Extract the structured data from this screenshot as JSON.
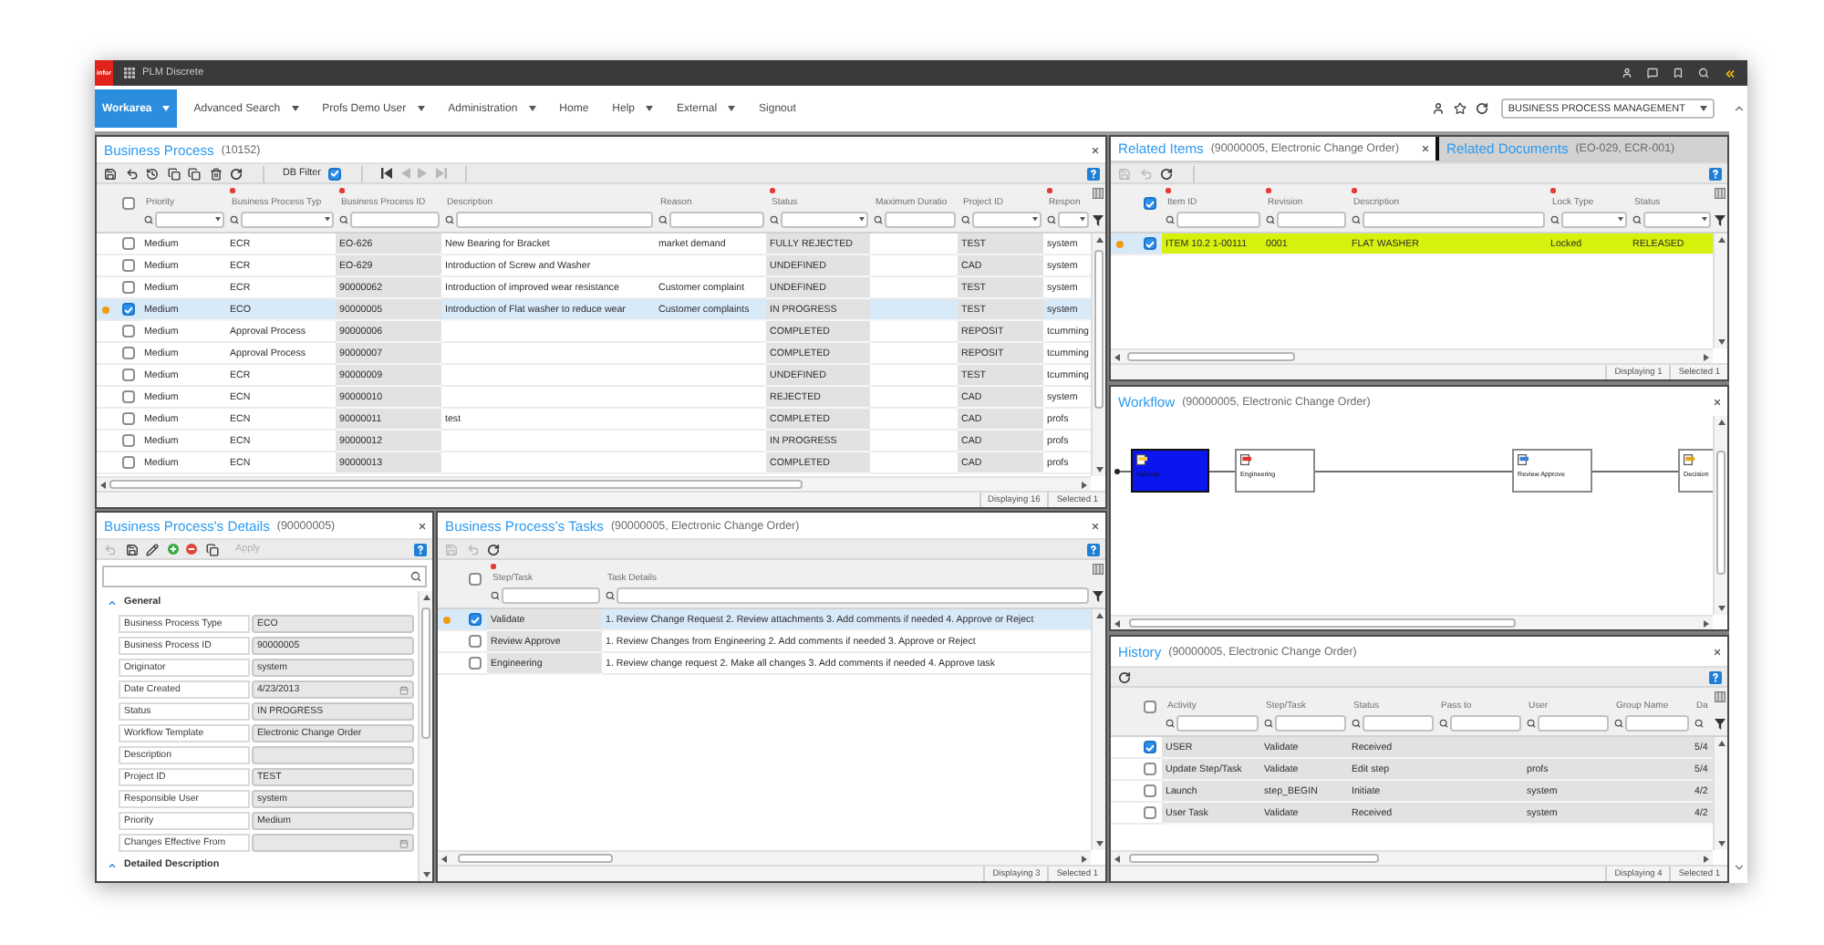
{
  "top_bar": {
    "logo": "infor",
    "app_name": "PLM Discrete"
  },
  "menu": {
    "items": [
      {
        "label": "Workarea",
        "selected": true,
        "has_dropdown": true
      },
      {
        "label": "Advanced Search",
        "selected": false,
        "has_dropdown": true
      },
      {
        "label": "Profs Demo User",
        "selected": false,
        "has_dropdown": true
      },
      {
        "label": "Administration",
        "selected": false,
        "has_dropdown": true
      },
      {
        "label": "Home",
        "selected": false,
        "has_dropdown": false
      },
      {
        "label": "Help",
        "selected": false,
        "has_dropdown": true
      },
      {
        "label": "External",
        "selected": false,
        "has_dropdown": true
      },
      {
        "label": "Signout",
        "selected": false,
        "has_dropdown": false
      }
    ],
    "workspace": "BUSINESS PROCESS MANAGEMENT"
  },
  "business_process": {
    "title": "Business Process",
    "subtitle": "(10152)",
    "tools": [
      {
        "kind": "save",
        "disabled": false
      },
      {
        "kind": "undo",
        "disabled": false
      },
      {
        "kind": "history",
        "disabled": false
      },
      {
        "kind": "copy",
        "disabled": false
      },
      {
        "kind": "copy",
        "disabled": false
      },
      {
        "kind": "delete",
        "disabled": false
      },
      {
        "kind": "refresh",
        "disabled": false
      }
    ],
    "db_filter": {
      "label": "DB Filter",
      "checked": true
    },
    "navigation": [
      {
        "kind": "first",
        "disabled": false
      },
      {
        "kind": "prev",
        "disabled": true
      },
      {
        "kind": "next",
        "disabled": true
      },
      {
        "kind": "last",
        "disabled": true
      }
    ],
    "all_checked": false,
    "columns": [
      {
        "label": "Priority",
        "required": false,
        "read_only": false,
        "kind": "select"
      },
      {
        "label": "Business Process Typ",
        "required": true,
        "read_only": false,
        "kind": "select"
      },
      {
        "label": "Business Process ID",
        "required": true,
        "read_only": true,
        "kind": "text"
      },
      {
        "label": "Description",
        "required": false,
        "read_only": false,
        "kind": "text"
      },
      {
        "label": "Reason",
        "required": false,
        "read_only": false,
        "kind": "text"
      },
      {
        "label": "Status",
        "required": true,
        "read_only": true,
        "kind": "select"
      },
      {
        "label": "Maximum Duratio",
        "required": false,
        "read_only": false,
        "kind": "text"
      },
      {
        "label": "Project ID",
        "required": false,
        "read_only": true,
        "kind": "select"
      },
      {
        "label": "Respon",
        "required": true,
        "read_only": false,
        "kind": "select"
      }
    ],
    "rows": [
      {
        "checked": false,
        "selected": false,
        "cells": [
          "Medium",
          "ECR",
          "EO-626",
          "New Bearing for Bracket",
          "market demand",
          "FULLY REJECTED",
          null,
          "TEST",
          "system"
        ]
      },
      {
        "checked": false,
        "selected": false,
        "cells": [
          "Medium",
          "ECR",
          "EO-629",
          "Introduction of Screw and Washer",
          null,
          "UNDEFINED",
          null,
          "CAD",
          "system"
        ]
      },
      {
        "checked": false,
        "selected": false,
        "cells": [
          "Medium",
          "ECR",
          "90000062",
          "Introduction of improved wear resistance",
          "Customer complaint",
          "UNDEFINED",
          null,
          "TEST",
          "system"
        ]
      },
      {
        "checked": true,
        "selected": true,
        "cells": [
          "Medium",
          "ECO",
          "90000005",
          "Introduction of Flat washer to reduce wear",
          "Customer complaints",
          "IN PROGRESS",
          null,
          "TEST",
          "system"
        ]
      },
      {
        "checked": false,
        "selected": false,
        "cells": [
          "Medium",
          "Approval Process",
          "90000006",
          null,
          null,
          "COMPLETED",
          null,
          "REPOSIT",
          "tcumming"
        ]
      },
      {
        "checked": false,
        "selected": false,
        "cells": [
          "Medium",
          "Approval Process",
          "90000007",
          null,
          null,
          "COMPLETED",
          null,
          "REPOSIT",
          "tcumming"
        ]
      },
      {
        "checked": false,
        "selected": false,
        "cells": [
          "Medium",
          "ECR",
          "90000009",
          null,
          null,
          "UNDEFINED",
          null,
          "TEST",
          "tcumming"
        ]
      },
      {
        "checked": false,
        "selected": false,
        "cells": [
          "Medium",
          "ECN",
          "90000010",
          null,
          null,
          "REJECTED",
          null,
          "CAD",
          "system"
        ]
      },
      {
        "checked": false,
        "selected": false,
        "cells": [
          "Medium",
          "ECN",
          "90000011",
          "test",
          null,
          "COMPLETED",
          null,
          "CAD",
          "profs"
        ]
      },
      {
        "checked": false,
        "selected": false,
        "cells": [
          "Medium",
          "ECN",
          "90000012",
          null,
          null,
          "IN PROGRESS",
          null,
          "CAD",
          "profs"
        ]
      },
      {
        "checked": false,
        "selected": false,
        "cells": [
          "Medium",
          "ECN",
          "90000013",
          null,
          null,
          "COMPLETED",
          null,
          "CAD",
          "profs"
        ]
      }
    ],
    "status": {
      "displaying": "Displaying 16",
      "selected": "Selected 1"
    }
  },
  "details": {
    "title": "Business Process's Details",
    "subtitle": "(90000005)",
    "tools": [
      {
        "kind": "undo",
        "disabled": true
      },
      {
        "kind": "save",
        "disabled": false
      },
      {
        "kind": "edit",
        "disabled": false
      },
      {
        "kind": "add",
        "disabled": false
      },
      {
        "kind": "remove",
        "disabled": false
      },
      {
        "kind": "copy",
        "disabled": false
      }
    ],
    "apply": {
      "label": "Apply",
      "disabled": true
    },
    "groups": [
      {
        "label": "General",
        "expanded": true,
        "properties": [
          {
            "label": "Business Process Type",
            "value": "ECO",
            "kind": "text"
          },
          {
            "label": "Business Process ID",
            "value": "90000005",
            "kind": "text"
          },
          {
            "label": "Originator",
            "value": "system",
            "kind": "text"
          },
          {
            "label": "Date Created",
            "value": "4/23/2013",
            "kind": "date"
          },
          {
            "label": "Status",
            "value": "IN PROGRESS",
            "kind": "text"
          },
          {
            "label": "Workflow Template",
            "value": "Electronic Change Order",
            "kind": "text"
          },
          {
            "label": "Description",
            "kind": "text"
          },
          {
            "label": "Project ID",
            "value": "TEST",
            "kind": "text"
          },
          {
            "label": "Responsible User",
            "value": "system",
            "kind": "text"
          },
          {
            "label": "Priority",
            "value": "Medium",
            "kind": "text"
          },
          {
            "label": "Changes Effective From",
            "kind": "date"
          }
        ]
      },
      {
        "label": "Detailed Description",
        "expanded": true
      }
    ]
  },
  "tasks": {
    "title": "Business Process's Tasks",
    "subtitle": "(90000005, Electronic Change Order)",
    "tools": [
      {
        "kind": "save",
        "disabled": true
      },
      {
        "kind": "undo",
        "disabled": true
      },
      {
        "kind": "refresh",
        "disabled": false
      }
    ],
    "all_checked": false,
    "columns": [
      {
        "label": "Step/Task",
        "required": true,
        "read_only": true,
        "kind": "text"
      },
      {
        "label": "Task Details",
        "required": false,
        "read_only": false,
        "kind": "text"
      }
    ],
    "rows": [
      {
        "checked": true,
        "selected": true,
        "cells": [
          "Validate",
          "1. Review Change Request 2. Review attachments 3. Add comments if needed 4. Approve or Reject"
        ]
      },
      {
        "checked": false,
        "selected": false,
        "cells": [
          "Review Approve",
          "1. Review Changes from Engineering 2. Add comments if needed 3. Approve or Reject"
        ]
      },
      {
        "checked": false,
        "selected": false,
        "cells": [
          "Engineering",
          "1. Review change request 2. Make all changes 3. Add comments if needed 4. Approve task"
        ]
      }
    ],
    "status": {
      "displaying": "Displaying 3",
      "selected": "Selected 1"
    }
  },
  "related": {
    "tabs": [
      {
        "title": "Related Items",
        "subtitle": "(90000005, Electronic Change Order)",
        "selected": true
      },
      {
        "title": "Related Documents",
        "subtitle": "(EO-029, ECR-001)",
        "selected": false
      }
    ],
    "tools": [
      {
        "kind": "save",
        "disabled": true
      },
      {
        "kind": "undo",
        "disabled": true
      },
      {
        "kind": "refresh",
        "disabled": false
      }
    ],
    "all_checked": true,
    "columns": [
      {
        "label": "Item ID",
        "required": true,
        "kind": "text"
      },
      {
        "label": "Revision",
        "required": true,
        "kind": "text"
      },
      {
        "label": "Description",
        "required": true,
        "kind": "text"
      },
      {
        "label": "Lock Type",
        "required": true,
        "kind": "select"
      },
      {
        "label": "Status",
        "required": false,
        "kind": "select"
      }
    ],
    "rows": [
      {
        "checked": true,
        "selected": true,
        "highlighted": true,
        "cells": [
          "ITEM 10.2 1-00111",
          "0001",
          "FLAT WASHER",
          "Locked",
          "RELEASED"
        ]
      }
    ],
    "status": {
      "displaying": "Displaying 1",
      "selected": "Selected 1"
    }
  },
  "workflow": {
    "title": "Workflow",
    "subtitle": "(90000005, Electronic Change Order)",
    "nodes": [
      {
        "label": "Validate",
        "current": true
      },
      {
        "label": "Engineering",
        "current": false
      },
      {
        "label": "Review Approve",
        "current": false
      },
      {
        "label": "Decision",
        "current": false
      }
    ]
  },
  "history": {
    "title": "History",
    "subtitle": "(90000005, Electronic Change Order)",
    "tools": [
      {
        "kind": "refresh",
        "disabled": false
      }
    ],
    "all_checked": false,
    "columns": [
      {
        "label": "Activity",
        "required": false,
        "read_only": true,
        "kind": "text"
      },
      {
        "label": "Step/Task",
        "required": false,
        "read_only": true,
        "kind": "text"
      },
      {
        "label": "Status",
        "required": false,
        "read_only": true,
        "kind": "text"
      },
      {
        "label": "Pass to",
        "required": false,
        "read_only": true,
        "kind": "text"
      },
      {
        "label": "User",
        "required": false,
        "read_only": true,
        "kind": "text"
      },
      {
        "label": "Group Name",
        "required": false,
        "read_only": true,
        "kind": "text"
      },
      {
        "label": "Da",
        "required": false,
        "read_only": true
      }
    ],
    "rows": [
      {
        "checked": true,
        "cells": [
          "USER",
          "Validate",
          "Received",
          null,
          null,
          null,
          "5/4"
        ]
      },
      {
        "checked": false,
        "cells": [
          "Update Step/Task",
          "Validate",
          "Edit step",
          null,
          "profs",
          null,
          "5/4"
        ]
      },
      {
        "checked": false,
        "cells": [
          "Launch",
          "step_BEGIN",
          "Initiate",
          null,
          "system",
          null,
          "4/2"
        ]
      },
      {
        "checked": false,
        "cells": [
          "User Task",
          "Validate",
          "Received",
          null,
          "system",
          null,
          "4/2"
        ]
      }
    ],
    "status": {
      "displaying": "Displaying 4",
      "selected": "Selected 1"
    }
  }
}
